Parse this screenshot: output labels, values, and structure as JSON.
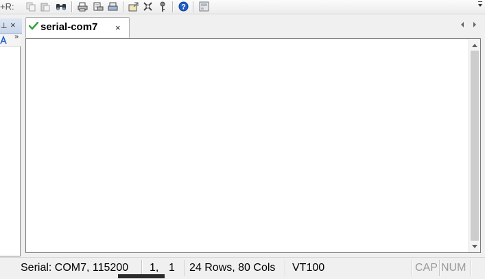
{
  "toolbar": {
    "shortcut_label": "+R:",
    "buttons": [
      {
        "name": "copy-icon"
      },
      {
        "name": "paste-icon"
      },
      {
        "name": "find-icon"
      },
      {
        "name": "print-icon"
      },
      {
        "name": "print-preview-icon"
      },
      {
        "name": "print-setup-icon"
      },
      {
        "name": "settings-icon"
      },
      {
        "name": "keymap-icon"
      },
      {
        "name": "key-icon"
      },
      {
        "name": "help-icon"
      },
      {
        "name": "about-icon"
      }
    ]
  },
  "left_panel": {
    "pin_glyph": "⊥",
    "close_glyph": "×",
    "more_glyph": "»"
  },
  "tab": {
    "title": "serial-com7",
    "close_glyph": "×"
  },
  "status_bar": {
    "connection": "Serial: COM7, 115200",
    "cursor_row": "1,",
    "cursor_col": "1",
    "size": "24 Rows, 80 Cols",
    "emulation": "VT100",
    "caps": "CAP",
    "num": "NUM"
  },
  "colors": {
    "check": "#3aa03a",
    "help": "#1f5fc7",
    "dock_header": "#c9d6ea"
  }
}
